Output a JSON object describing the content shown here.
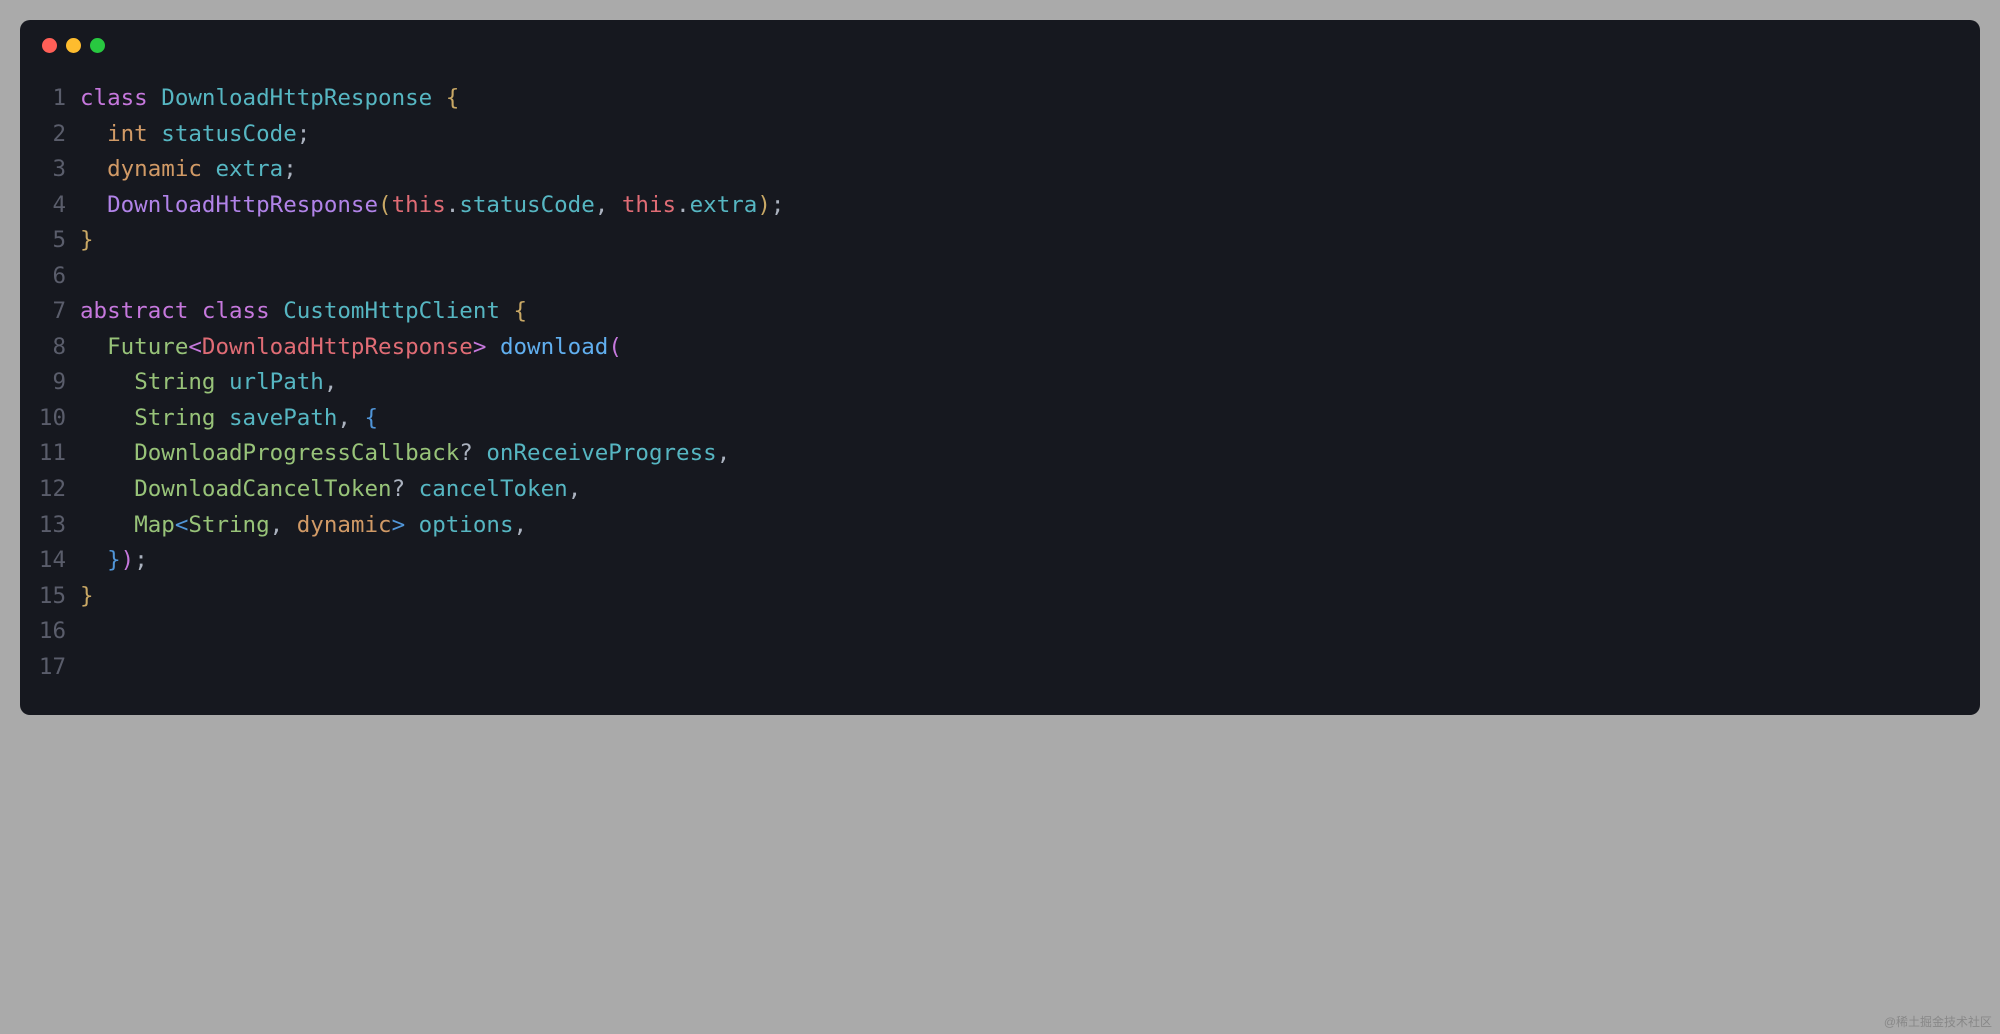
{
  "window_controls": {
    "close": "close",
    "minimize": "minimize",
    "maximize": "maximize"
  },
  "code": {
    "lines": [
      {
        "num": "1",
        "indent": "",
        "tokens": [
          {
            "t": "class ",
            "c": "kw-purple"
          },
          {
            "t": "DownloadHttpResponse",
            "c": "type-teal"
          },
          {
            "t": " ",
            "c": "punct"
          },
          {
            "t": "{",
            "c": "punct-gold"
          }
        ]
      },
      {
        "num": "2",
        "indent": "  ",
        "tokens": [
          {
            "t": "int",
            "c": "kw-yellow"
          },
          {
            "t": " ",
            "c": "punct"
          },
          {
            "t": "statusCode",
            "c": "prop-teal"
          },
          {
            "t": ";",
            "c": "punct"
          }
        ]
      },
      {
        "num": "3",
        "indent": "  ",
        "tokens": [
          {
            "t": "dynamic",
            "c": "kw-yellow"
          },
          {
            "t": " ",
            "c": "punct"
          },
          {
            "t": "extra",
            "c": "prop-teal"
          },
          {
            "t": ";",
            "c": "punct"
          }
        ]
      },
      {
        "num": "4",
        "indent": "  ",
        "tokens": [
          {
            "t": "DownloadHttpResponse",
            "c": "ctor-purple"
          },
          {
            "t": "(",
            "c": "punct-gold"
          },
          {
            "t": "this",
            "c": "this-red"
          },
          {
            "t": ".",
            "c": "punct"
          },
          {
            "t": "statusCode",
            "c": "prop-teal"
          },
          {
            "t": ", ",
            "c": "punct"
          },
          {
            "t": "this",
            "c": "this-red"
          },
          {
            "t": ".",
            "c": "punct"
          },
          {
            "t": "extra",
            "c": "prop-teal"
          },
          {
            "t": ")",
            "c": "punct-gold"
          },
          {
            "t": ";",
            "c": "punct"
          }
        ]
      },
      {
        "num": "5",
        "indent": "",
        "tokens": [
          {
            "t": "}",
            "c": "punct-gold"
          }
        ]
      },
      {
        "num": "6",
        "indent": "",
        "tokens": []
      },
      {
        "num": "7",
        "indent": "",
        "tokens": [
          {
            "t": "abstract ",
            "c": "kw-purple"
          },
          {
            "t": "class ",
            "c": "kw-purple"
          },
          {
            "t": "CustomHttpClient",
            "c": "type-teal"
          },
          {
            "t": " ",
            "c": "punct"
          },
          {
            "t": "{",
            "c": "punct-gold"
          }
        ]
      },
      {
        "num": "8",
        "indent": "  ",
        "tokens": [
          {
            "t": "Future",
            "c": "type-green"
          },
          {
            "t": "<",
            "c": "punct-mag"
          },
          {
            "t": "DownloadHttpResponse",
            "c": "type-red"
          },
          {
            "t": ">",
            "c": "punct-mag"
          },
          {
            "t": " ",
            "c": "punct"
          },
          {
            "t": "download",
            "c": "fn-blue"
          },
          {
            "t": "(",
            "c": "punct-mag"
          }
        ]
      },
      {
        "num": "9",
        "indent": "    ",
        "tokens": [
          {
            "t": "String",
            "c": "type-green"
          },
          {
            "t": " ",
            "c": "punct"
          },
          {
            "t": "urlPath",
            "c": "prop-teal"
          },
          {
            "t": ",",
            "c": "punct"
          }
        ]
      },
      {
        "num": "10",
        "indent": "    ",
        "tokens": [
          {
            "t": "String",
            "c": "type-green"
          },
          {
            "t": " ",
            "c": "punct"
          },
          {
            "t": "savePath",
            "c": "prop-teal"
          },
          {
            "t": ", ",
            "c": "punct"
          },
          {
            "t": "{",
            "c": "punct-blue"
          }
        ]
      },
      {
        "num": "11",
        "indent": "    ",
        "tokens": [
          {
            "t": "DownloadProgressCallback",
            "c": "type-green"
          },
          {
            "t": "? ",
            "c": "punct"
          },
          {
            "t": "onReceiveProgress",
            "c": "prop-teal"
          },
          {
            "t": ",",
            "c": "punct"
          }
        ]
      },
      {
        "num": "12",
        "indent": "    ",
        "tokens": [
          {
            "t": "DownloadCancelToken",
            "c": "type-green"
          },
          {
            "t": "? ",
            "c": "punct"
          },
          {
            "t": "cancelToken",
            "c": "prop-teal"
          },
          {
            "t": ",",
            "c": "punct"
          }
        ]
      },
      {
        "num": "13",
        "indent": "    ",
        "tokens": [
          {
            "t": "Map",
            "c": "type-green"
          },
          {
            "t": "<",
            "c": "punct-blue"
          },
          {
            "t": "String",
            "c": "type-green"
          },
          {
            "t": ", ",
            "c": "punct"
          },
          {
            "t": "dynamic",
            "c": "kw-yellow"
          },
          {
            "t": ">",
            "c": "punct-blue"
          },
          {
            "t": " ",
            "c": "punct"
          },
          {
            "t": "options",
            "c": "prop-teal"
          },
          {
            "t": ",",
            "c": "punct"
          }
        ]
      },
      {
        "num": "14",
        "indent": "  ",
        "tokens": [
          {
            "t": "}",
            "c": "punct-blue"
          },
          {
            "t": ")",
            "c": "punct-mag"
          },
          {
            "t": ";",
            "c": "punct"
          }
        ]
      },
      {
        "num": "15",
        "indent": "",
        "tokens": [
          {
            "t": "}",
            "c": "punct-gold"
          }
        ]
      },
      {
        "num": "16",
        "indent": "",
        "tokens": []
      },
      {
        "num": "17",
        "indent": "",
        "tokens": []
      }
    ]
  },
  "footer": "@稀土掘金技术社区"
}
